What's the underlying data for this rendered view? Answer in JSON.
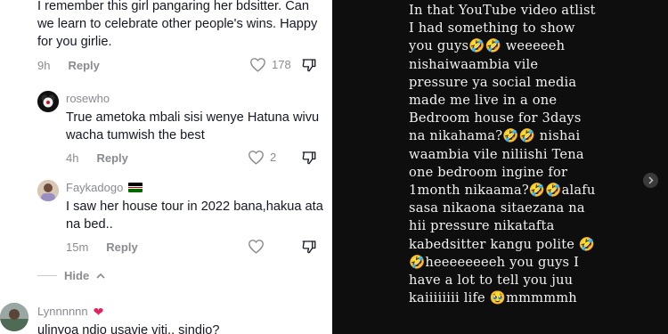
{
  "thread": {
    "top_comment": {
      "text": "I remember this girl pangaring her bdsitter. Can we learn to celebrate other people's wins. Happy for you girlie.",
      "time": "9h",
      "reply_label": "Reply",
      "likes": "178"
    },
    "replies": [
      {
        "username": "rosewho",
        "text": "True ametoka mbali sisi wenye Hatuna wivu wacha tumwish the best",
        "time": "4h",
        "reply_label": "Reply",
        "likes": "2"
      },
      {
        "username": "Faykadogo",
        "text": "I saw her house tour in 2022 bana,hakua ata na bed..",
        "time": "15m",
        "reply_label": "Reply",
        "likes": ""
      }
    ],
    "hide_label": "Hide",
    "next_comment": {
      "username": "Lynnnnnn",
      "text": "ulinyoa ndio usavie viti.. sindio?"
    }
  },
  "story": {
    "text": "In that YouTube video atlist I had something to show you guys🤣🤣 weeeeeh nishaiwaambia vile pressure ya social media made me live in a one Bedroom house for 3days na nikahama?🤣🤣 nishai waambia vile niliishi Tena one bedroom ingine for 1month nikaama?🤣🤣alafu sasa nikaona sitaezana na hii pressure nikatafta kabedsitter kangu polite 🤣🤣heeeeeeeeh you guys I have a lot to tell you juu kaiiiiiiii life 🥹mmmmmh"
  },
  "colors": {
    "left_bg": "#ffffff",
    "right_bg": "#0e0e0e",
    "text_primary": "#161823",
    "text_secondary": "#8a8b91",
    "heart_red": "#e0245e"
  },
  "icons": [
    "heart-outline-icon",
    "dislike-icon",
    "chevron-up-icon",
    "kenya-flag-icon",
    "red-heart-icon",
    "chevron-right-icon"
  ]
}
